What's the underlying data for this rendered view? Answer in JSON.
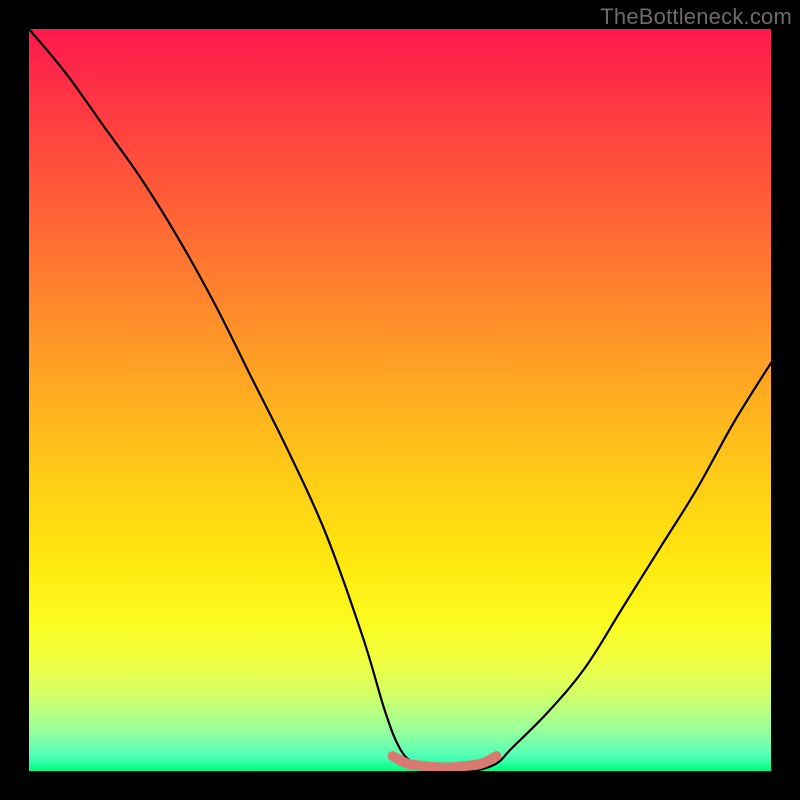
{
  "attribution": "TheBottleneck.com",
  "chart_data": {
    "type": "line",
    "title": "",
    "xlabel": "",
    "ylabel": "",
    "xlim": [
      0,
      100
    ],
    "ylim": [
      0,
      100
    ],
    "series": [
      {
        "name": "bottleneck-curve",
        "x": [
          0,
          5,
          10,
          15,
          20,
          25,
          30,
          35,
          40,
          45,
          48,
          50,
          52,
          55,
          58,
          60,
          63,
          65,
          70,
          75,
          80,
          85,
          90,
          95,
          100
        ],
        "values": [
          100,
          94,
          87,
          80,
          72,
          63,
          53,
          43,
          32,
          18,
          8,
          3,
          1,
          0,
          0,
          0,
          1,
          3,
          8,
          14,
          22,
          30,
          38,
          47,
          55
        ]
      },
      {
        "name": "optimal-range-marker",
        "x": [
          49,
          51,
          53,
          55,
          57,
          59,
          61,
          63
        ],
        "values": [
          2,
          1,
          0.7,
          0.5,
          0.5,
          0.7,
          1,
          2
        ]
      }
    ],
    "background_gradient": {
      "type": "vertical",
      "stops": [
        {
          "pos": 0.0,
          "color": "#ff1a4d"
        },
        {
          "pos": 0.5,
          "color": "#ffb41e"
        },
        {
          "pos": 0.8,
          "color": "#fbfb20"
        },
        {
          "pos": 1.0,
          "color": "#00ff80"
        }
      ]
    }
  }
}
